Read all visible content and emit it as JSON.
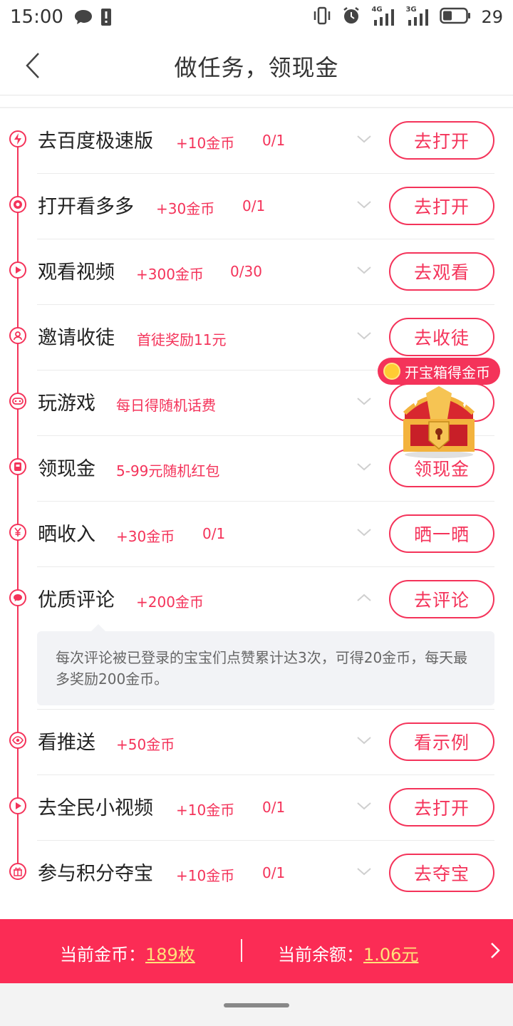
{
  "status": {
    "time": "15:00",
    "battery": "29",
    "net1": "4G",
    "net2": "3G"
  },
  "header": {
    "title": "做任务，领现金"
  },
  "tasks": [
    {
      "name": "去百度极速版",
      "reward": "+10金币",
      "progress": "0/1",
      "button": "去打开",
      "icon": "lightning-icon"
    },
    {
      "name": "打开看多多",
      "reward": "+30金币",
      "progress": "0/1",
      "button": "去打开",
      "icon": "kanduoduo-icon"
    },
    {
      "name": "观看视频",
      "reward": "+300金币",
      "progress": "0/30",
      "button": "去观看",
      "icon": "play-icon"
    },
    {
      "name": "邀请收徒",
      "reward": "首徒奖励11元",
      "progress": "",
      "button": "去收徒",
      "icon": "user-icon"
    },
    {
      "name": "玩游戏",
      "reward": "每日得随机话费",
      "progress": "",
      "button": "",
      "icon": "gamepad-icon"
    },
    {
      "name": "领现金",
      "reward": "5-99元随机红包",
      "progress": "",
      "button": "领现金",
      "icon": "wallet-icon"
    },
    {
      "name": "晒收入",
      "reward": "+30金币",
      "progress": "0/1",
      "button": "晒一晒",
      "icon": "yuan-icon"
    },
    {
      "name": "优质评论",
      "reward": "+200金币",
      "progress": "",
      "button": "去评论",
      "icon": "comment-icon"
    },
    {
      "name": "看推送",
      "reward": "+50金币",
      "progress": "",
      "button": "看示例",
      "icon": "eye-icon"
    },
    {
      "name": "去全民小视频",
      "reward": "+10金币",
      "progress": "0/1",
      "button": "去打开",
      "icon": "play-icon"
    },
    {
      "name": "参与积分夺宝",
      "reward": "+10金币",
      "progress": "0/1",
      "button": "去夺宝",
      "icon": "gift-icon"
    }
  ],
  "comment_description": "每次评论被已登录的宝宝们点赞累计达3次，可得20金币，每天最多奖励200金币。",
  "chest": {
    "badge": "开宝箱得金币"
  },
  "bottom": {
    "coin_label": "当前金币：",
    "coin_value": "189枚",
    "balance_label": "当前余额：",
    "balance_value": "1.06元"
  },
  "colors": {
    "accent": "#f4335a",
    "bar": "#fb2c55",
    "highlight": "#ffe27a"
  }
}
